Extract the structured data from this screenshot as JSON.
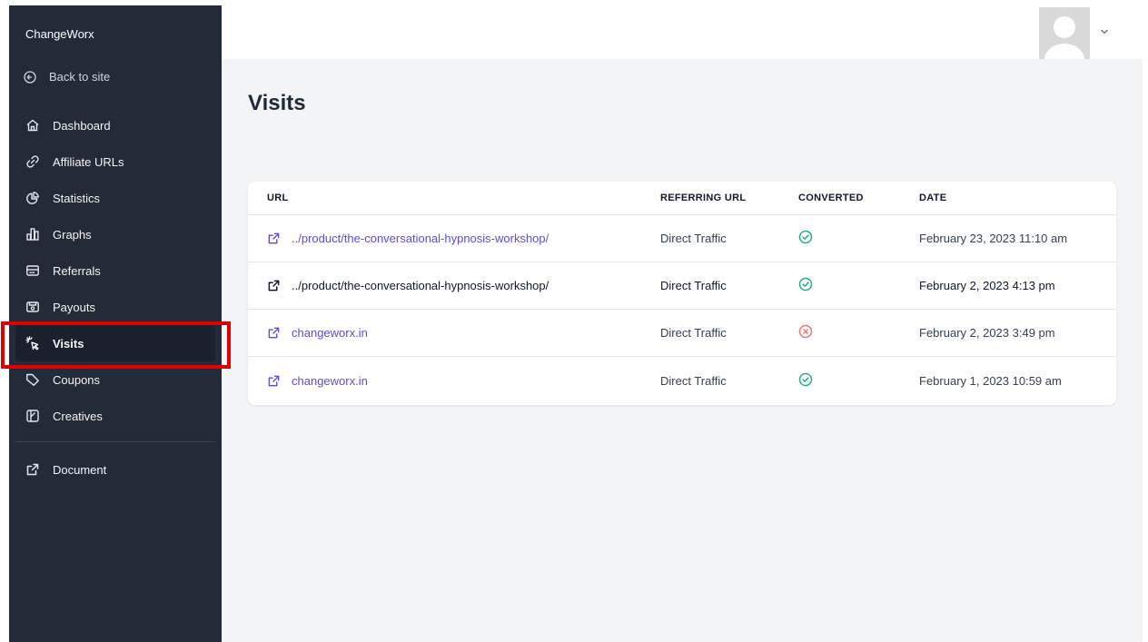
{
  "sidebar": {
    "brand": "ChangeWorx",
    "back_label": "Back to site",
    "items": [
      {
        "label": "Dashboard",
        "icon": "home-icon"
      },
      {
        "label": "Affiliate URLs",
        "icon": "link-icon"
      },
      {
        "label": "Statistics",
        "icon": "pie-chart-icon"
      },
      {
        "label": "Graphs",
        "icon": "bar-chart-icon"
      },
      {
        "label": "Referrals",
        "icon": "referrals-icon"
      },
      {
        "label": "Payouts",
        "icon": "payouts-icon"
      },
      {
        "label": "Visits",
        "icon": "cursor-click-icon",
        "active": true
      },
      {
        "label": "Coupons",
        "icon": "tag-icon"
      },
      {
        "label": "Creatives",
        "icon": "creatives-icon"
      }
    ],
    "document_label": "Document"
  },
  "main": {
    "title": "Visits",
    "table": {
      "headers": [
        "URL",
        "REFERRING URL",
        "CONVERTED",
        "DATE"
      ],
      "rows": [
        {
          "url": "../product/the-conversational-hypnosis-workshop/",
          "referring": "Direct Traffic",
          "converted": true,
          "date": "February 23, 2023 11:10 am"
        },
        {
          "url": "../product/the-conversational-hypnosis-workshop/",
          "referring": "Direct Traffic",
          "converted": true,
          "date": "February 2, 2023 4:13 pm"
        },
        {
          "url": "changeworx.in",
          "referring": "Direct Traffic",
          "converted": false,
          "date": "February 2, 2023 3:49 pm"
        },
        {
          "url": "changeworx.in",
          "referring": "Direct Traffic",
          "converted": true,
          "date": "February 1, 2023 10:59 am"
        }
      ]
    }
  },
  "colors": {
    "sidebar_bg": "#232b39",
    "accent_link": "#5b4fd8",
    "success": "#22b07d",
    "danger": "#f87171",
    "highlight": "#e00000"
  }
}
